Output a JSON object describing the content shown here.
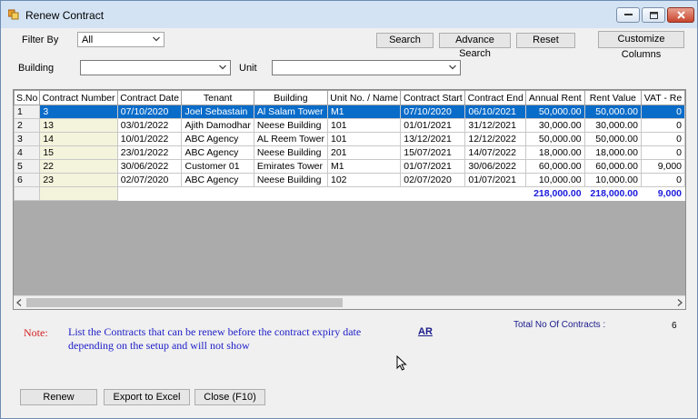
{
  "window": {
    "title": "Renew Contract"
  },
  "filters": {
    "filter_by_label": "Filter By",
    "filter_by_value": "All",
    "building_label": "Building",
    "building_value": "",
    "unit_label": "Unit",
    "unit_value": ""
  },
  "toolbar": {
    "search": "Search",
    "advance_search": "Advance Search",
    "reset": "Reset",
    "customize_columns": "Customize Columns"
  },
  "table": {
    "columns": [
      "S.No",
      "Contract Number",
      "Contract Date",
      "Tenant",
      "Building",
      "Unit No. / Name",
      "Contract Start",
      "Contract End",
      "Annual Rent",
      "Rent Value",
      "VAT - Re"
    ],
    "rows": [
      [
        "1",
        "3",
        "07/10/2020",
        "Joel Sebastain",
        "Al Salam Tower",
        "M1",
        "07/10/2020",
        "06/10/2021",
        "50,000.00",
        "50,000.00",
        "0"
      ],
      [
        "2",
        "13",
        "03/01/2022",
        "Ajith Damodhar",
        "Neese Building",
        "101",
        "01/01/2021",
        "31/12/2021",
        "30,000.00",
        "30,000.00",
        "0"
      ],
      [
        "3",
        "14",
        "10/01/2022",
        "ABC Agency",
        "AL Reem Tower",
        "101",
        "13/12/2021",
        "12/12/2022",
        "50,000.00",
        "50,000.00",
        "0"
      ],
      [
        "4",
        "15",
        "23/01/2022",
        "ABC Agency",
        "Neese Building",
        "201",
        "15/07/2021",
        "14/07/2022",
        "18,000.00",
        "18,000.00",
        "0"
      ],
      [
        "5",
        "22",
        "30/06/2022",
        "Customer 01",
        "Emirates Tower",
        "M1",
        "01/07/2021",
        "30/06/2022",
        "60,000.00",
        "60,000.00",
        "9,000"
      ],
      [
        "6",
        "23",
        "02/07/2020",
        "ABC Agency",
        "Neese Building",
        "102",
        "02/07/2020",
        "01/07/2021",
        "10,000.00",
        "10,000.00",
        "0"
      ]
    ],
    "totals": {
      "annual_rent": "218,000.00",
      "rent_value": "218,000.00",
      "vat": "9,000"
    }
  },
  "note": {
    "label": "Note:",
    "text": "List the Contracts that can be renew before the contract expiry date depending on the setup and will not show",
    "link": "AR"
  },
  "summary": {
    "total_label": "Total No Of Contracts :",
    "total_value": "6"
  },
  "footer": {
    "renew": "Renew",
    "export": "Export to Excel",
    "close": "Close (F10)"
  },
  "colors": {
    "selection": "#0a6cc9",
    "note_label": "#d42020",
    "note_text": "#2020c8",
    "totals": "#1a1adc"
  }
}
